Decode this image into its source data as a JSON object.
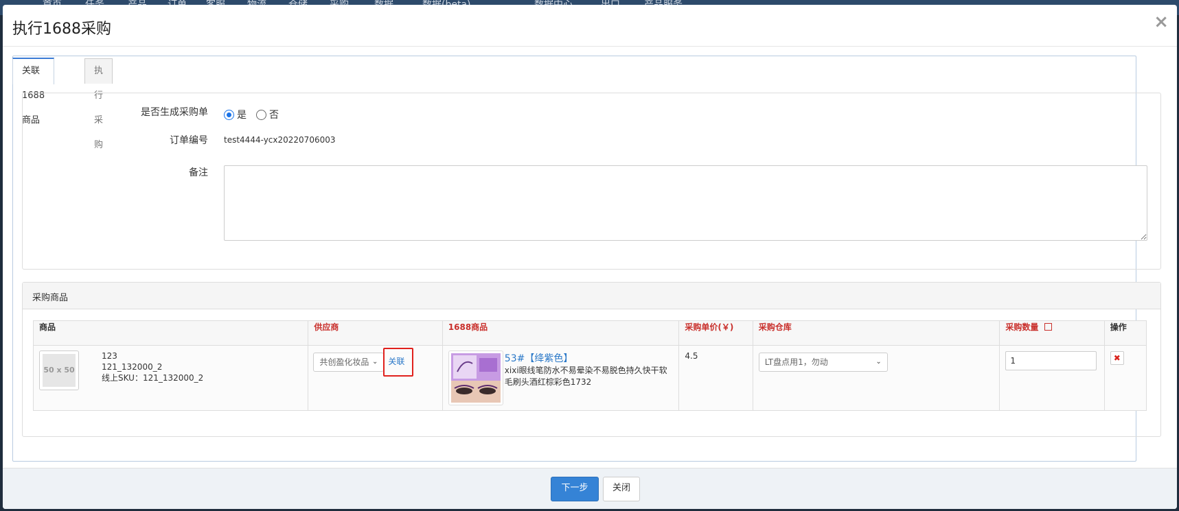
{
  "background_nav": [
    "首页",
    "任务",
    "产品",
    "订单",
    "客服",
    "物流",
    "仓储",
    "采购",
    "数据",
    "数据(beta)",
    "数据中心",
    "出口",
    "产品服务"
  ],
  "dialog": {
    "title": "执行1688采购",
    "close_glyph": "×"
  },
  "tabs": [
    {
      "label": "关联1688商品",
      "active": true
    },
    {
      "label": "执行采购",
      "active": false
    }
  ],
  "form": {
    "generate_po_label": "是否生成采购单",
    "option_yes": "是",
    "option_no": "否",
    "selected": "是",
    "order_no_label": "订单编号",
    "order_no_value": "test4444-ycx20220706003",
    "remark_label": "备注",
    "remark_value": ""
  },
  "goods": {
    "section_title": "采购商品",
    "columns": [
      "商品",
      "供应商",
      "1688商品",
      "采购单价(￥)",
      "采购仓库",
      "采购数量",
      "操作"
    ],
    "row": {
      "thumb_text": "50 x 50",
      "name": "123",
      "sku": "121_132000_2",
      "online_sku": "线上SKU：121_132000_2",
      "supplier": "共创盈化妆品",
      "link_label": "关联",
      "product_title": "53#【绛紫色】",
      "product_desc": "xixi眼线笔防水不易晕染不易脱色持久快干软毛刷头酒红棕彩色1732",
      "unit_price": "4.5",
      "warehouse": "LT盘点用1，勿动",
      "quantity": "1",
      "delete_glyph": "✖"
    }
  },
  "footer": {
    "next_label": "下一步",
    "close_label": "关闭"
  },
  "colors": {
    "accent": "#3583d6",
    "required_header": "#c9302c",
    "highlight": "#e0201c"
  }
}
